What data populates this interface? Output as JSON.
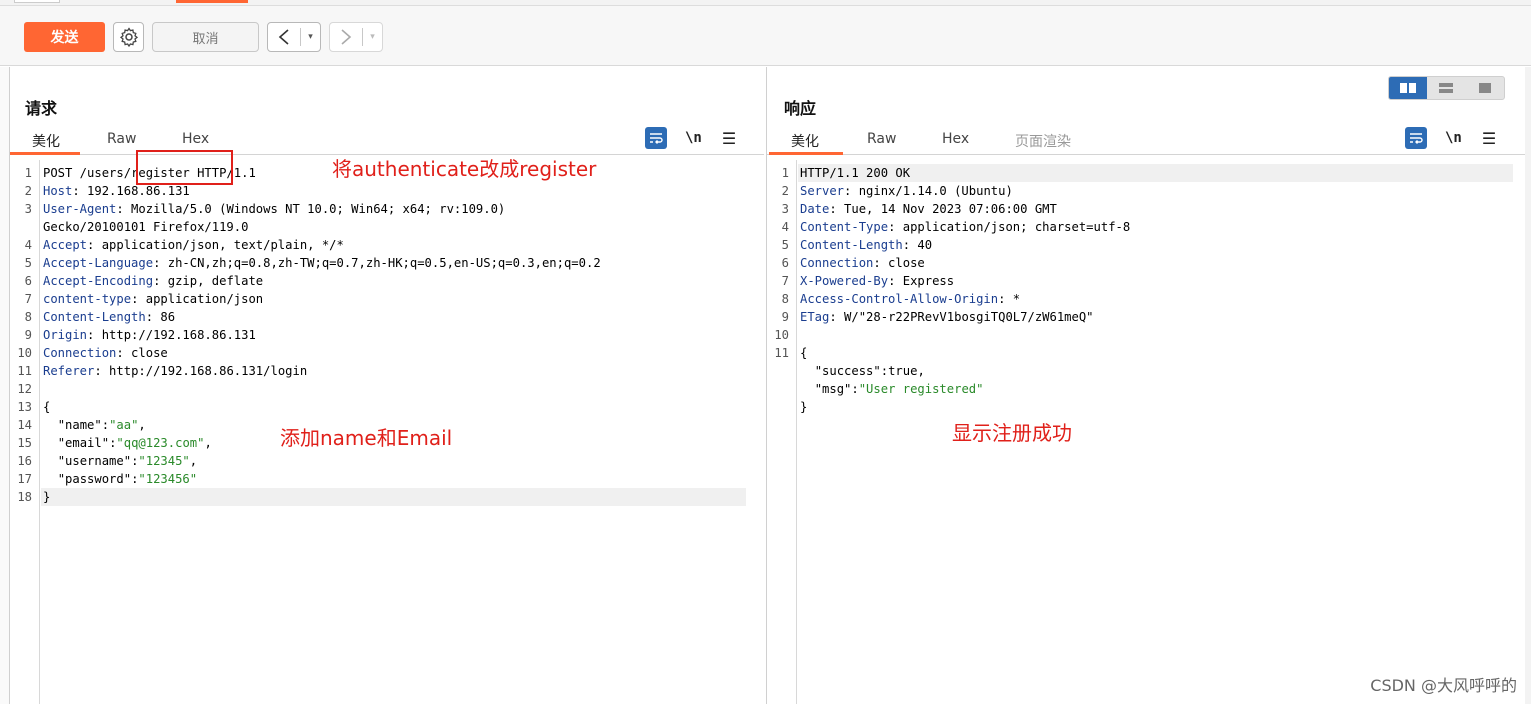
{
  "toolbar": {
    "send_label": "发送",
    "cancel_label": "取消",
    "back_arrow": "<",
    "forward_arrow": ">",
    "dropdown_glyph": "▾"
  },
  "request": {
    "title": "请求",
    "tabs": [
      "美化",
      "Raw",
      "Hex"
    ],
    "active_tab": "美化",
    "newline_label": "\\n",
    "menu_glyph": "☰",
    "line_numbers": [
      "1",
      "2",
      "3",
      "",
      "4",
      "5",
      "6",
      "7",
      "8",
      "9",
      "10",
      "11",
      "12",
      "13",
      "14",
      "15",
      "16",
      "17",
      "18"
    ],
    "lines": [
      {
        "text": "POST /users/register HTTP/1.1"
      },
      {
        "key": "Host",
        "value": " 192.168.86.131"
      },
      {
        "key": "User-Agent",
        "value": " Mozilla/5.0 (Windows NT 10.0; Win64; x64; rv:109.0)"
      },
      {
        "text": "Gecko/20100101 Firefox/119.0"
      },
      {
        "key": "Accept",
        "value": " application/json, text/plain, */*"
      },
      {
        "key": "Accept-Language",
        "value": " zh-CN,zh;q=0.8,zh-TW;q=0.7,zh-HK;q=0.5,en-US;q=0.3,en;q=0.2"
      },
      {
        "key": "Accept-Encoding",
        "value": " gzip, deflate"
      },
      {
        "key": "content-type",
        "value": " application/json"
      },
      {
        "key": "Content-Length",
        "value": " 86"
      },
      {
        "key": "Origin",
        "value": " http://192.168.86.131"
      },
      {
        "key": "Connection",
        "value": " close"
      },
      {
        "key": "Referer",
        "value": " http://192.168.86.131/login"
      },
      {
        "text": ""
      },
      {
        "text": "{"
      },
      {
        "jkey": "\"name\"",
        "jval": "\"aa\"",
        "trail": ","
      },
      {
        "jkey": "\"email\"",
        "jval": "\"qq@123.com\"",
        "trail": ","
      },
      {
        "jkey": "\"username\"",
        "jval": "\"12345\"",
        "trail": ","
      },
      {
        "jkey": "\"password\"",
        "jval": "\"123456\"",
        "trail": ""
      },
      {
        "text": "}"
      }
    ]
  },
  "response": {
    "title": "响应",
    "tabs": [
      "美化",
      "Raw",
      "Hex",
      "页面渲染"
    ],
    "active_tab": "美化",
    "newline_label": "\\n",
    "menu_glyph": "☰",
    "line_numbers": [
      "1",
      "2",
      "3",
      "4",
      "5",
      "6",
      "7",
      "8",
      "9",
      "10",
      "11",
      "",
      "",
      ""
    ],
    "lines": [
      {
        "text": "HTTP/1.1 200 OK"
      },
      {
        "key": "Server",
        "value": " nginx/1.14.0 (Ubuntu)"
      },
      {
        "key": "Date",
        "value": " Tue, 14 Nov 2023 07:06:00 GMT"
      },
      {
        "key": "Content-Type",
        "value": " application/json; charset=utf-8"
      },
      {
        "key": "Content-Length",
        "value": " 40"
      },
      {
        "key": "Connection",
        "value": " close"
      },
      {
        "key": "X-Powered-By",
        "value": " Express"
      },
      {
        "key": "Access-Control-Allow-Origin",
        "value": " *"
      },
      {
        "key": "ETag",
        "value": " W/\"28-r22PRevV1bosgiTQ0L7/zW61meQ\""
      },
      {
        "text": ""
      },
      {
        "text": "{"
      },
      {
        "jkey": "\"success\"",
        "jraw": "true",
        "trail": ","
      },
      {
        "jkey": "\"msg\"",
        "jval": "\"User registered\"",
        "trail": ""
      },
      {
        "text": "}"
      }
    ]
  },
  "annotations": {
    "register_note": "将authenticate改成register",
    "body_note": "添加name和Email",
    "success_note": "显示注册成功"
  },
  "watermark": "CSDN @大风呼呼的",
  "colors": {
    "accent": "#ff6633",
    "header_key": "#1a3d8f",
    "json_string": "#2a8a2a",
    "annotation": "#e0201a",
    "icon_blue": "#2d6cb5"
  }
}
